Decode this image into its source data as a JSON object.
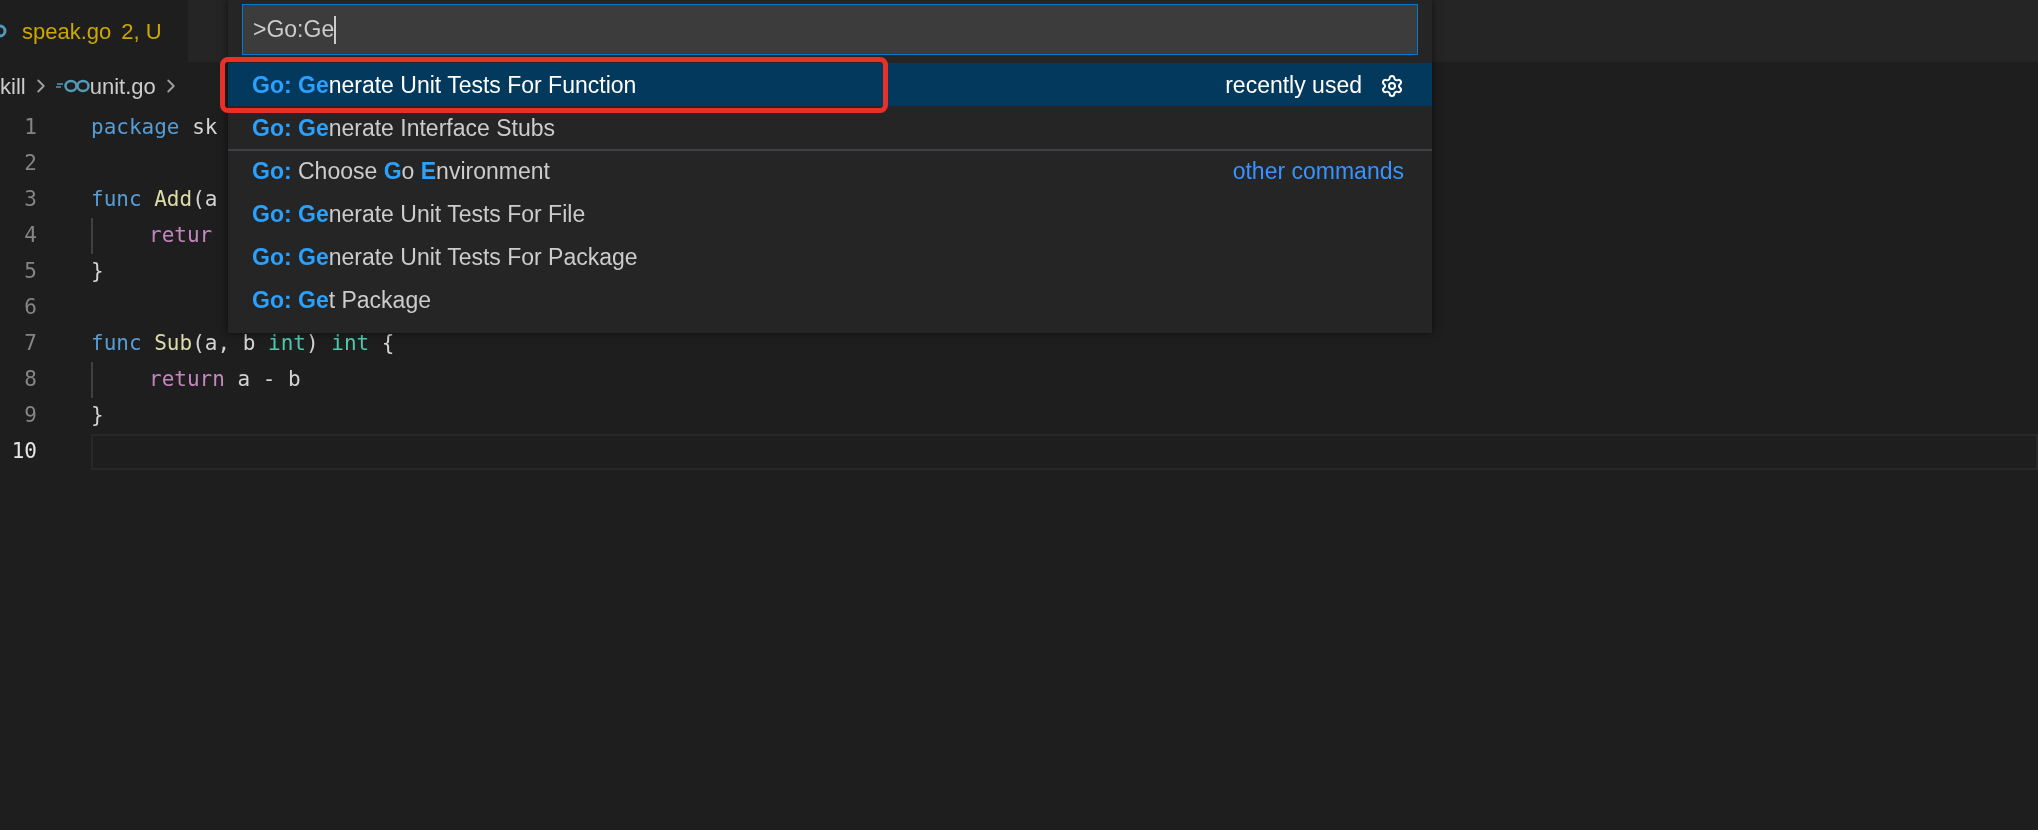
{
  "tab": {
    "filename": "speak.go",
    "status": "2, U"
  },
  "breadcrumb": [
    "kill",
    "unit.go"
  ],
  "editor": {
    "lines": [
      {
        "number": "1",
        "current": false,
        "indent": false,
        "tokens": [
          {
            "kind": "keyword",
            "text": "package"
          },
          {
            "kind": "plain",
            "text": " sk"
          }
        ]
      },
      {
        "number": "2",
        "current": false,
        "indent": false
      },
      {
        "number": "3",
        "current": false,
        "indent": false,
        "tokens": [
          {
            "kind": "keyword",
            "text": "func"
          },
          {
            "kind": "function",
            "text": " Add"
          },
          {
            "kind": "plain",
            "text": "(a"
          }
        ]
      },
      {
        "number": "4",
        "current": false,
        "indent": true,
        "tokens": [
          {
            "kind": "control",
            "text": "retur"
          }
        ]
      },
      {
        "number": "5",
        "current": false,
        "indent": false,
        "tokens": [
          {
            "kind": "plain",
            "text": "}"
          }
        ]
      },
      {
        "number": "6",
        "current": false,
        "indent": false
      },
      {
        "number": "7",
        "current": false,
        "indent": false,
        "tokens": [
          {
            "kind": "keyword",
            "text": "func"
          },
          {
            "kind": "function",
            "text": " Sub"
          },
          {
            "kind": "plain",
            "text": "(a, b "
          },
          {
            "kind": "type",
            "text": "int"
          },
          {
            "kind": "plain",
            "text": ") "
          },
          {
            "kind": "type",
            "text": "int"
          },
          {
            "kind": "plain",
            "text": " {"
          }
        ]
      },
      {
        "number": "8",
        "current": false,
        "indent": true,
        "tokens": [
          {
            "kind": "control",
            "text": "return"
          },
          {
            "kind": "plain",
            "text": " a - b"
          }
        ]
      },
      {
        "number": "9",
        "current": false,
        "indent": false,
        "tokens": [
          {
            "kind": "plain",
            "text": "}"
          }
        ]
      },
      {
        "number": "10",
        "current": true,
        "indent": false
      }
    ]
  },
  "command_palette": {
    "input": {
      "value": ">Go:Ge"
    },
    "items": [
      {
        "label": "**Go: Ge**nerate Unit Tests For Function",
        "detail": "recently used",
        "gear": true,
        "selected": true,
        "outlined": true
      },
      {
        "label": "**Go: Ge**nerate Interface Stubs",
        "selected": false,
        "outlined": false,
        "separator_before": false
      },
      {
        "label": "**Go:** Choose **G**o **E**nvironment",
        "detail": "other commands",
        "selected": false,
        "outlined": false,
        "separator_before": true
      },
      {
        "label": "**Go: Ge**nerate Unit Tests For File",
        "selected": false,
        "outlined": false,
        "separator_before": false
      },
      {
        "label": "**Go: Ge**nerate Unit Tests For Package",
        "selected": false,
        "outlined": false,
        "separator_before": false
      },
      {
        "label": "**Go: Ge**t Package",
        "selected": false,
        "outlined": false,
        "separator_before": false
      }
    ]
  }
}
